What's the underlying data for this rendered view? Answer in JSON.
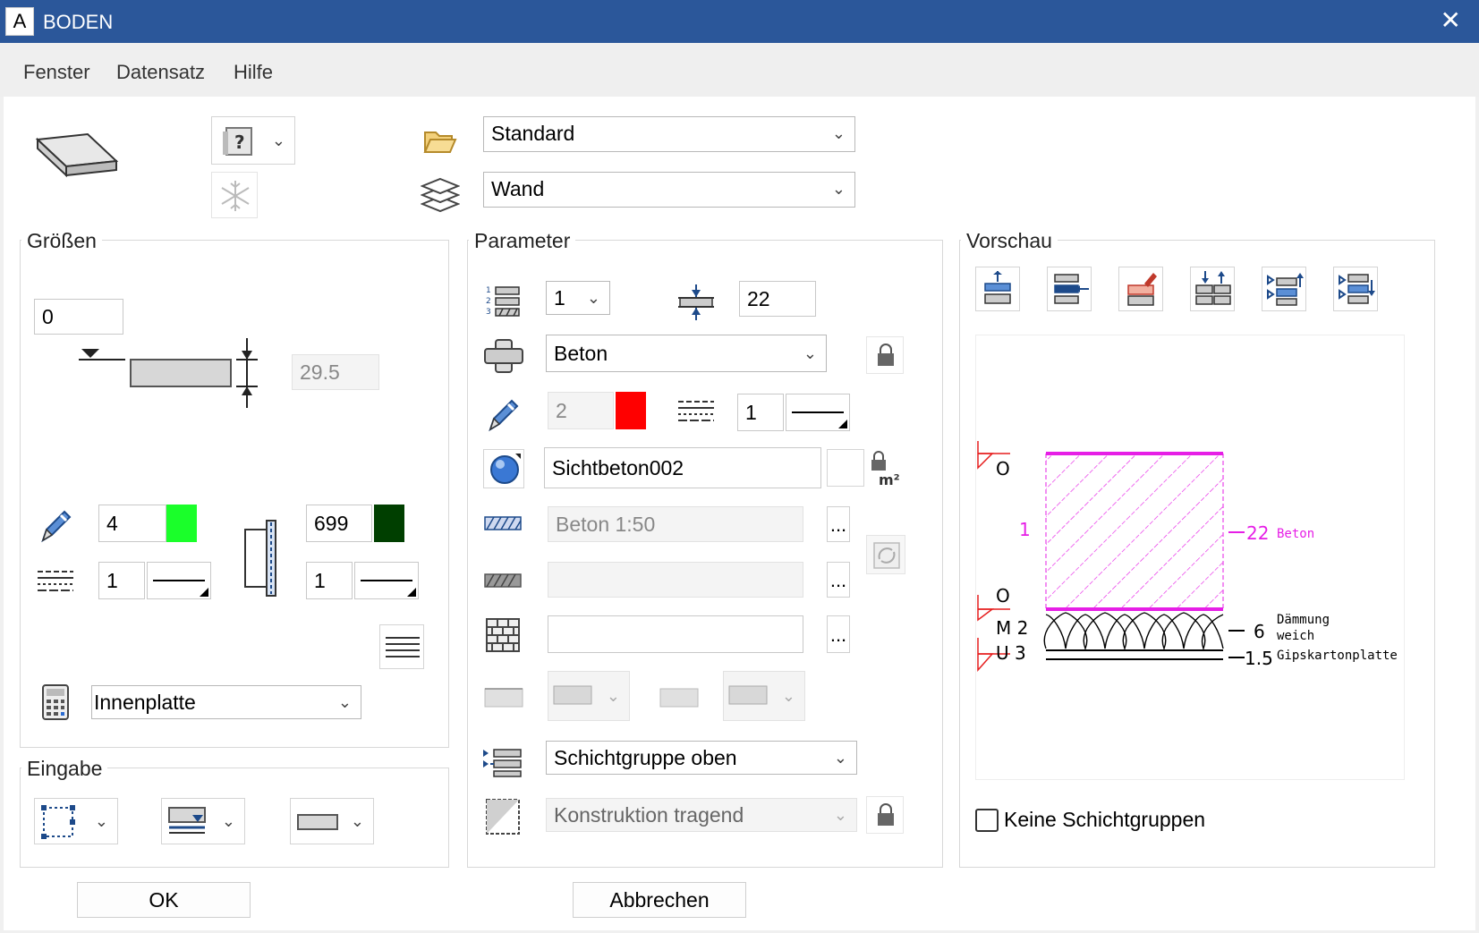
{
  "window": {
    "title": "BODEN",
    "app_icon_letter": "A",
    "close": "✕"
  },
  "menu": [
    "Fenster",
    "Datensatz",
    "Hilfe"
  ],
  "top": {
    "favorite_dropdown": "Standard",
    "layer_dropdown": "Wand",
    "help_icon_label": "?"
  },
  "groessen": {
    "title": "Größen",
    "offset_value": "0",
    "thickness_value": "29.5",
    "pen_value": "4",
    "pen_color": "#1aff2a",
    "line_value": "1",
    "color_value": "699",
    "color_swatch": "#003f00",
    "line2_value": "1",
    "calc_dropdown": "Innenplatte"
  },
  "eingabe": {
    "title": "Eingabe"
  },
  "parameter": {
    "title": "Parameter",
    "layer_number": "1",
    "layer_thickness": "22",
    "material": "Beton",
    "pen_value": "2",
    "pen_color": "#ff0000",
    "line_value": "1",
    "surface": "Sichtbeton002",
    "hatch": "Beton 1:50",
    "pattern": "",
    "fill": "",
    "more_label": "...",
    "layer_group": "Schichtgruppe oben",
    "construction": "Konstruktion tragend"
  },
  "vorschau": {
    "title": "Vorschau",
    "checkbox_label": "Keine Schichtgruppen",
    "labels": {
      "top_o": "O",
      "layer1_num": "1",
      "layer1_thick": "22",
      "layer1_mat": "Beton",
      "mid_o": "O",
      "m2": "M 2",
      "layer2_thick": "6",
      "layer2_mat": "Dämmung weich",
      "u3": "U 3",
      "layer3_thick": "1.5",
      "layer3_mat": "Gipskartonplatte"
    }
  },
  "buttons": {
    "ok": "OK",
    "cancel": "Abbrechen"
  }
}
